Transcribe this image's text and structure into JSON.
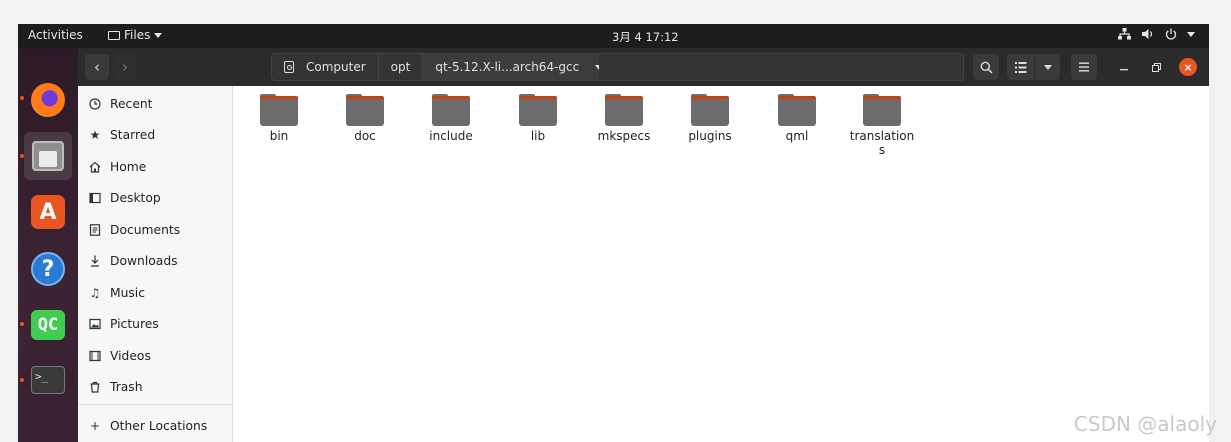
{
  "topbar": {
    "activities": "Activities",
    "app_menu": "Files",
    "clock": "3月 4  17:12",
    "tray_icons": [
      "network-icon",
      "volume-icon",
      "power-icon",
      "system-menu-caret"
    ]
  },
  "dock": {
    "apps": [
      "firefox",
      "files",
      "software",
      "help",
      "qt-creator",
      "terminal"
    ],
    "qc_label": "QC",
    "terminal_prompt": ">_"
  },
  "headerbar": {
    "breadcrumbs": [
      "Computer",
      "opt",
      "qt-5.12.X-li...arch64-gcc"
    ],
    "close_glyph": "×"
  },
  "sidebar": {
    "items": [
      {
        "label": "Recent",
        "icon": "clock-icon"
      },
      {
        "label": "Starred",
        "icon": "star-icon"
      },
      {
        "label": "Home",
        "icon": "home-icon"
      },
      {
        "label": "Desktop",
        "icon": "desktop-icon"
      },
      {
        "label": "Documents",
        "icon": "document-icon"
      },
      {
        "label": "Downloads",
        "icon": "download-icon"
      },
      {
        "label": "Music",
        "icon": "music-icon"
      },
      {
        "label": "Pictures",
        "icon": "picture-icon"
      },
      {
        "label": "Videos",
        "icon": "video-icon"
      },
      {
        "label": "Trash",
        "icon": "trash-icon"
      }
    ],
    "other_locations": "Other Locations"
  },
  "folders": [
    "bin",
    "doc",
    "include",
    "lib",
    "mkspecs",
    "plugins",
    "qml",
    "translations"
  ],
  "watermark": "CSDN @alaoly",
  "colors": {
    "accent": "#e95420",
    "folder": "#6c6c6c",
    "topbar": "#1d1d1d"
  }
}
